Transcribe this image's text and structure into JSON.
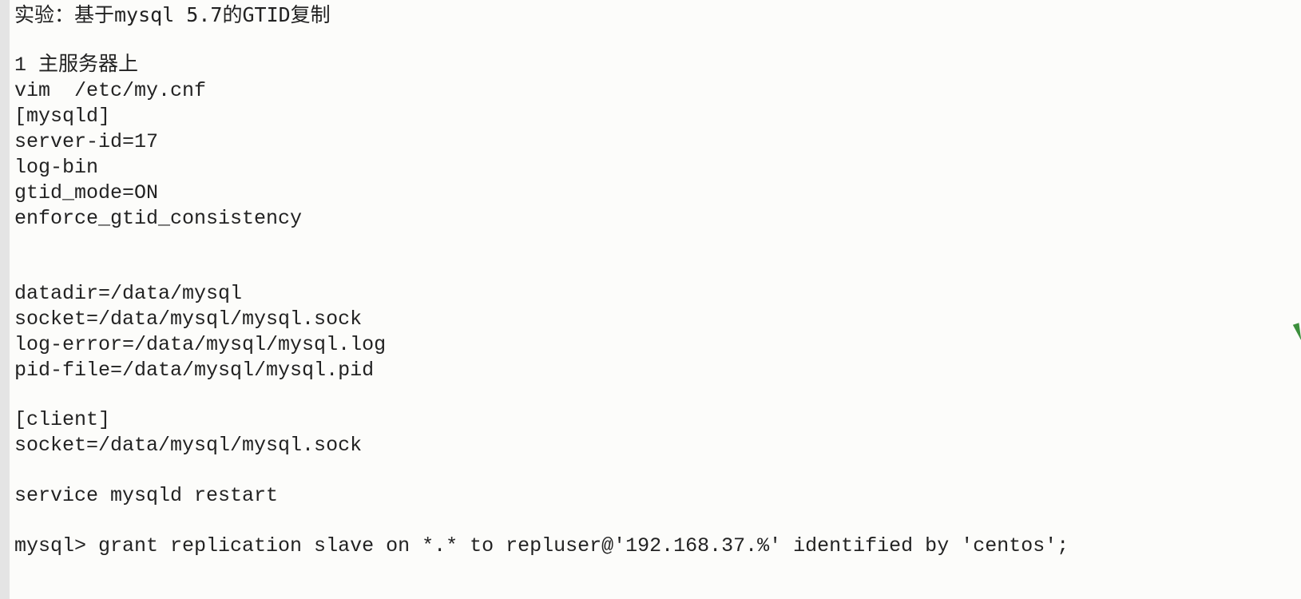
{
  "document": {
    "lines": [
      "实验：基于mysql 5.7的GTID复制",
      "",
      "1 主服务器上",
      "vim  /etc/my.cnf",
      "[mysqld]",
      "server-id=17",
      "log-bin",
      "gtid_mode=ON",
      "enforce_gtid_consistency",
      "",
      "",
      "datadir=/data/mysql",
      "socket=/data/mysql/mysql.sock",
      "log-error=/data/mysql/mysql.log",
      "pid-file=/data/mysql/mysql.pid",
      "",
      "[client]",
      "socket=/data/mysql/mysql.sock",
      "",
      "service mysqld restart",
      "",
      "mysql> grant replication slave on *.* to repluser@'192.168.37.%' identified by 'centos';"
    ]
  },
  "colors": {
    "background": "#fcfcfa",
    "text": "#222222",
    "gutter": "#e4e4e4",
    "cursor_mark": "#3c8f3c"
  }
}
